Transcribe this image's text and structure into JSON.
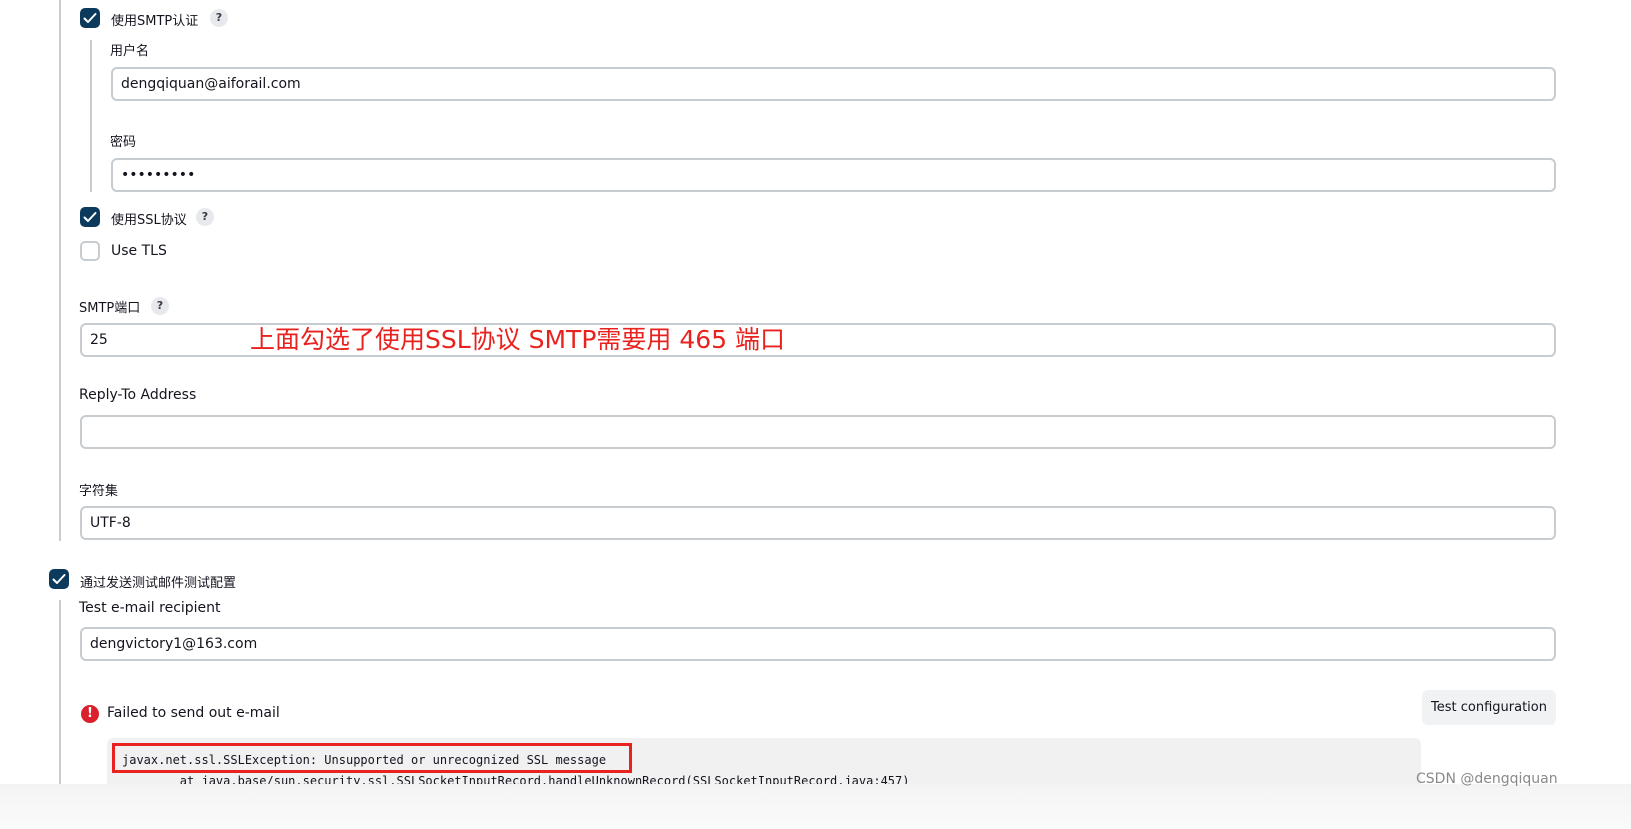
{
  "smtp_auth": {
    "checkbox_label": "使用SMTP认证",
    "help": "?",
    "username_label": "用户名",
    "username_value": "dengqiquan@aiforail.com",
    "password_label": "密码",
    "password_value": "•••••••••"
  },
  "ssl": {
    "label": "使用SSL协议",
    "help": "?"
  },
  "tls": {
    "label": "Use TLS"
  },
  "smtp_port": {
    "label": "SMTP端口",
    "help": "?",
    "value": "25"
  },
  "annotation": "上面勾选了使用SSL协议 SMTP需要用 465 端口",
  "reply_to": {
    "label": "Reply-To Address",
    "value": ""
  },
  "charset": {
    "label": "字符集",
    "value": "UTF-8"
  },
  "test_mail": {
    "checkbox_label": "通过发送测试邮件测试配置",
    "recipient_label": "Test e-mail recipient",
    "recipient_value": "dengvictory1@163.com",
    "button_label": "Test configuration",
    "error_icon": "!",
    "error_message": "Failed to send out e-mail",
    "trace_line_1": "javax.net.ssl.SSLException: Unsupported or unrecognized SSL message",
    "trace_line_2": "        at java.base/sun.security.ssl.SSLSocketInputRecord.handleUnknownRecord(SSLSocketInputRecord.java:457)"
  },
  "watermark": "CSDN @dengqiquan",
  "colors": {
    "checkbox_checked": "#0b3a5c",
    "annotation_red": "#e8231f",
    "error_red": "#d9202b"
  }
}
